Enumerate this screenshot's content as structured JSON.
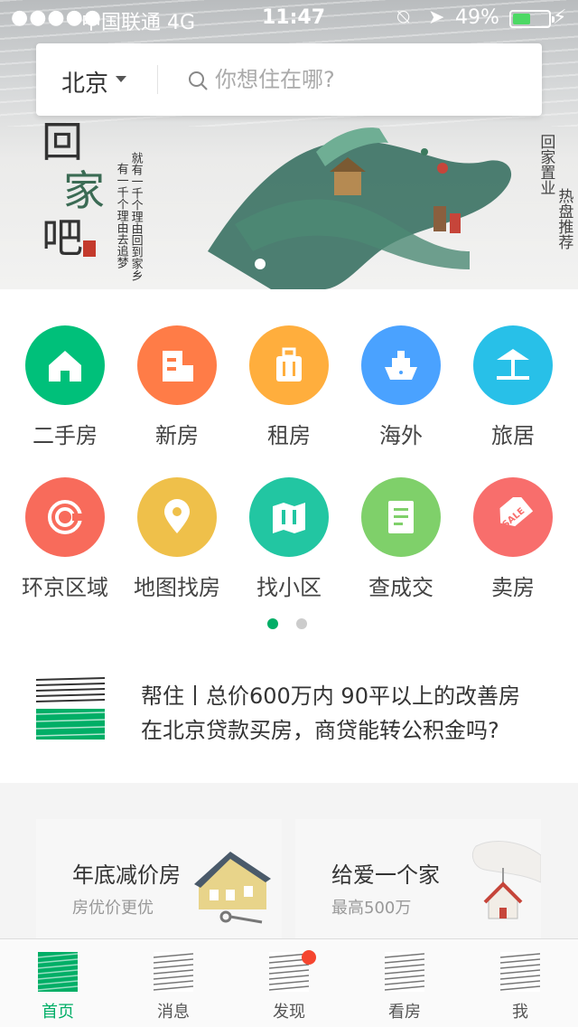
{
  "status_bar": {
    "signal": "●●●●●",
    "carrier": "中国联通  4G",
    "time": "11:47",
    "lock_icon": "⍉",
    "location_icon": "➤",
    "battery_text": "49%",
    "battery_level": 0.49,
    "charging_icon": "⚡"
  },
  "search": {
    "city": "北京",
    "placeholder": "你想住在哪?"
  },
  "banner": {
    "title_chars": [
      "回",
      "家",
      "吧"
    ],
    "poem_line1": "就有一千个理由回到家乡",
    "poem_line2": "有一千个理由去追梦",
    "right_text1": "回家置业",
    "right_text2": "热盘推荐",
    "big_char": "家"
  },
  "categories": [
    {
      "label": "二手房",
      "icon": "house-icon",
      "color": "#00c07a"
    },
    {
      "label": "新房",
      "icon": "building-icon",
      "color": "#ff7c47"
    },
    {
      "label": "租房",
      "icon": "luggage-icon",
      "color": "#ffae3d"
    },
    {
      "label": "海外",
      "icon": "ship-icon",
      "color": "#4aa2ff"
    },
    {
      "label": "旅居",
      "icon": "beach-umbrella-icon",
      "color": "#28c0e8"
    },
    {
      "label": "环京区域",
      "icon": "ring-icon",
      "color": "#f86b5b"
    },
    {
      "label": "地图找房",
      "icon": "map-pin-icon",
      "color": "#efc04a"
    },
    {
      "label": "找小区",
      "icon": "map-icon",
      "color": "#22c6a2"
    },
    {
      "label": "查成交",
      "icon": "document-icon",
      "color": "#7fd06a"
    },
    {
      "label": "卖房",
      "icon": "sale-tag-icon",
      "color": "#f86e6c"
    }
  ],
  "pager": {
    "pages": 2,
    "active_index": 0
  },
  "news": {
    "line1": "帮住丨总价600万内 90平以上的改善房",
    "line2": "在北京贷款买房，商贷能转公积金吗?"
  },
  "promos": [
    {
      "title": "年底减价房",
      "subtitle": "房优价更优",
      "icon": "house-with-keys-icon"
    },
    {
      "title": "给爱一个家",
      "subtitle": "最高500万",
      "icon": "hand-holding-house-icon"
    }
  ],
  "tabs": [
    {
      "label": "首页",
      "active": true
    },
    {
      "label": "消息",
      "active": false
    },
    {
      "label": "发现",
      "active": false,
      "badge": true
    },
    {
      "label": "看房",
      "active": false
    },
    {
      "label": "我",
      "active": false
    }
  ],
  "colors": {
    "brand_green": "#00ae66",
    "badge_red": "#f5452f",
    "pager_active": "#00ae66",
    "pager_inactive": "#cccccc"
  }
}
